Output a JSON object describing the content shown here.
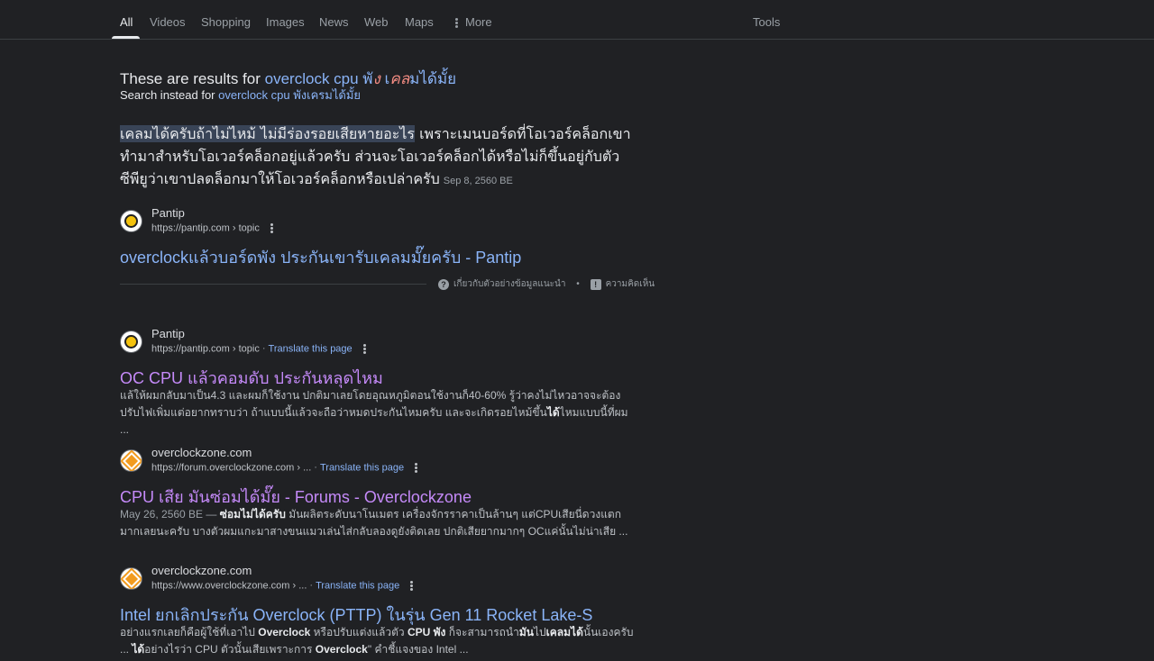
{
  "tabs": {
    "all": "All",
    "videos": "Videos",
    "shopping": "Shopping",
    "images": "Images",
    "news": "News",
    "web": "Web",
    "maps": "Maps",
    "more": "More",
    "tools": "Tools"
  },
  "correction": {
    "prefix": "These are results for",
    "query_main": "overclock cpu",
    "query_fix_1": " พั",
    "query_fix_2": "ง",
    "query_fix_3": " เ",
    "query_fix_4": "ค",
    "query_fix_5": "ล",
    "query_fix_6": "มได้มั้ย",
    "instead_label": "Search instead for",
    "instead_query": "overclock cpu พังเครมได้มั้ย"
  },
  "featured": {
    "highlight": "เคลมได้ครับถ้าไม่ไหม้ ไม่มีร่องรอยเสียหายอะไร",
    "rest": " เพราะเมนบอร์ดที่โอเวอร์คล็อกเขาทำมาสำหรับโอเวอร์คล็อกอยู่แล้วครับ ส่วนจะโอเวอร์คล็อกได้หรือไม่ก็ขึ้นอยู่กับตัวซีพียูว่าเขาปลดล็อกมาให้โอเวอร์คล็อกหรือเปล่าครับ",
    "date": "Sep 8, 2560 BE",
    "site_name": "Pantip",
    "site_url": "https://pantip.com › topic",
    "title": "overclockแล้วบอร์ดพัง ประกันเขารับเคลมมั๊ยครับ - Pantip",
    "about": "เกี่ยวกับตัวอย่างข้อมูลแนะนำ",
    "feedback": "ความคิดเห็น"
  },
  "results": [
    {
      "site_name": "Pantip",
      "site_url": "https://pantip.com › topic",
      "translate": "Translate this page",
      "title": "OC CPU แล้วคอมดับ ประกันหลุดไหม",
      "snippet_1": "แล้ให้ผมกลับมาเป็น4.3 และผมก็ใช้งาน ปกติมาเลยโดยอุณหภูมิตอนใช้งานก็40-60% รู้ว่าคงไม่ไหวอาจจะต้องปรับไฟเพิ่มแต่อยากทราบว่า ถ้าแบบนี้แล้วจะถือว่าหมดประกันไหมครับ และจะเกิดรอยไหม้ขึ้น",
      "snippet_bold": "ได้",
      "snippet_2": "ไหมแบบนี้ที่ผม ..."
    },
    {
      "site_name": "overclockzone.com",
      "site_url": "https://forum.overclockzone.com › ...",
      "translate": "Translate this page",
      "title": "CPU เสีย มันซ่อมได้มั๊ย - Forums - Overclockzone",
      "date": "May 26, 2560 BE — ",
      "snippet_bold": "ซ่อมไม่ได้ครับ",
      "snippet_2": " มันผลิตระดับนาโนเมตร เครื่องจักรราคาเป็นล้านๆ แต่CPUเสียนี่ดวงแตกมากเลยนะครับ บางตัวผมแกะมาสางขนแมวเล่นไส่กลับลองดูยังติดเลย ปกติเสียยากมากๆ OCแค่นั้นไม่น่าเสีย ..."
    },
    {
      "site_name": "overclockzone.com",
      "site_url": "https://www.overclockzone.com › ...",
      "translate": "Translate this page",
      "title": "Intel ยกเลิกประกัน Overclock (PTTP) ในรุ่น Gen 11 Rocket Lake-S",
      "s1": "อย่างแรกเลยก็คือผู้ใช้ที่เอาไป ",
      "b1": "Overclock",
      "s2": " หรือปรับแต่งแล้วตัว ",
      "b2": "CPU พัง",
      "s3": " ก็จะสามารถนำ",
      "b3": "มัน",
      "s4": "ไป",
      "b4": "เคลมได้",
      "s5": "นั้นเองครับ ... ",
      "b5": "ได้",
      "s6": "อย่างไรว่า CPU ตัวนั้นเสียเพราะการ ",
      "b6": "Overclock",
      "s7": "\" คำชี้แจงของ Intel ..."
    }
  ]
}
